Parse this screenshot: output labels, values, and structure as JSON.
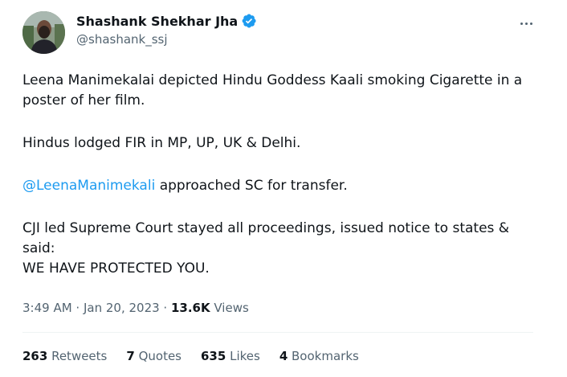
{
  "author": {
    "display_name": "Shashank Shekhar Jha",
    "handle": "@shashank_ssj",
    "verified_icon": "verified-badge-icon",
    "avatar_color": "#6f7f6b"
  },
  "tweet": {
    "para1": "Leena Manimekalai depicted Hindu Goddess Kaali smoking Cigarette in a poster of her film.",
    "para2": "Hindus lodged FIR in MP, UP, UK & Delhi.",
    "para3_mention": "@LeenaManimekali",
    "para3_rest": " approached SC for transfer.",
    "para4_line1": "CJI led Supreme Court stayed all proceedings, issued notice to states & said:",
    "para4_line2": "WE HAVE PROTECTED YOU."
  },
  "meta": {
    "time": "3:49 AM",
    "separator": " · ",
    "date": "Jan 20, 2023",
    "views_count": "13.6K",
    "views_label": " Views"
  },
  "stats": {
    "retweets_count": "263",
    "retweets_label": " Retweets",
    "quotes_count": "7",
    "quotes_label": " Quotes",
    "likes_count": "635",
    "likes_label": " Likes",
    "bookmarks_count": "4",
    "bookmarks_label": " Bookmarks"
  },
  "colors": {
    "link": "#1d9bf0",
    "secondary_text": "#536471",
    "primary_text": "#0f1419"
  }
}
